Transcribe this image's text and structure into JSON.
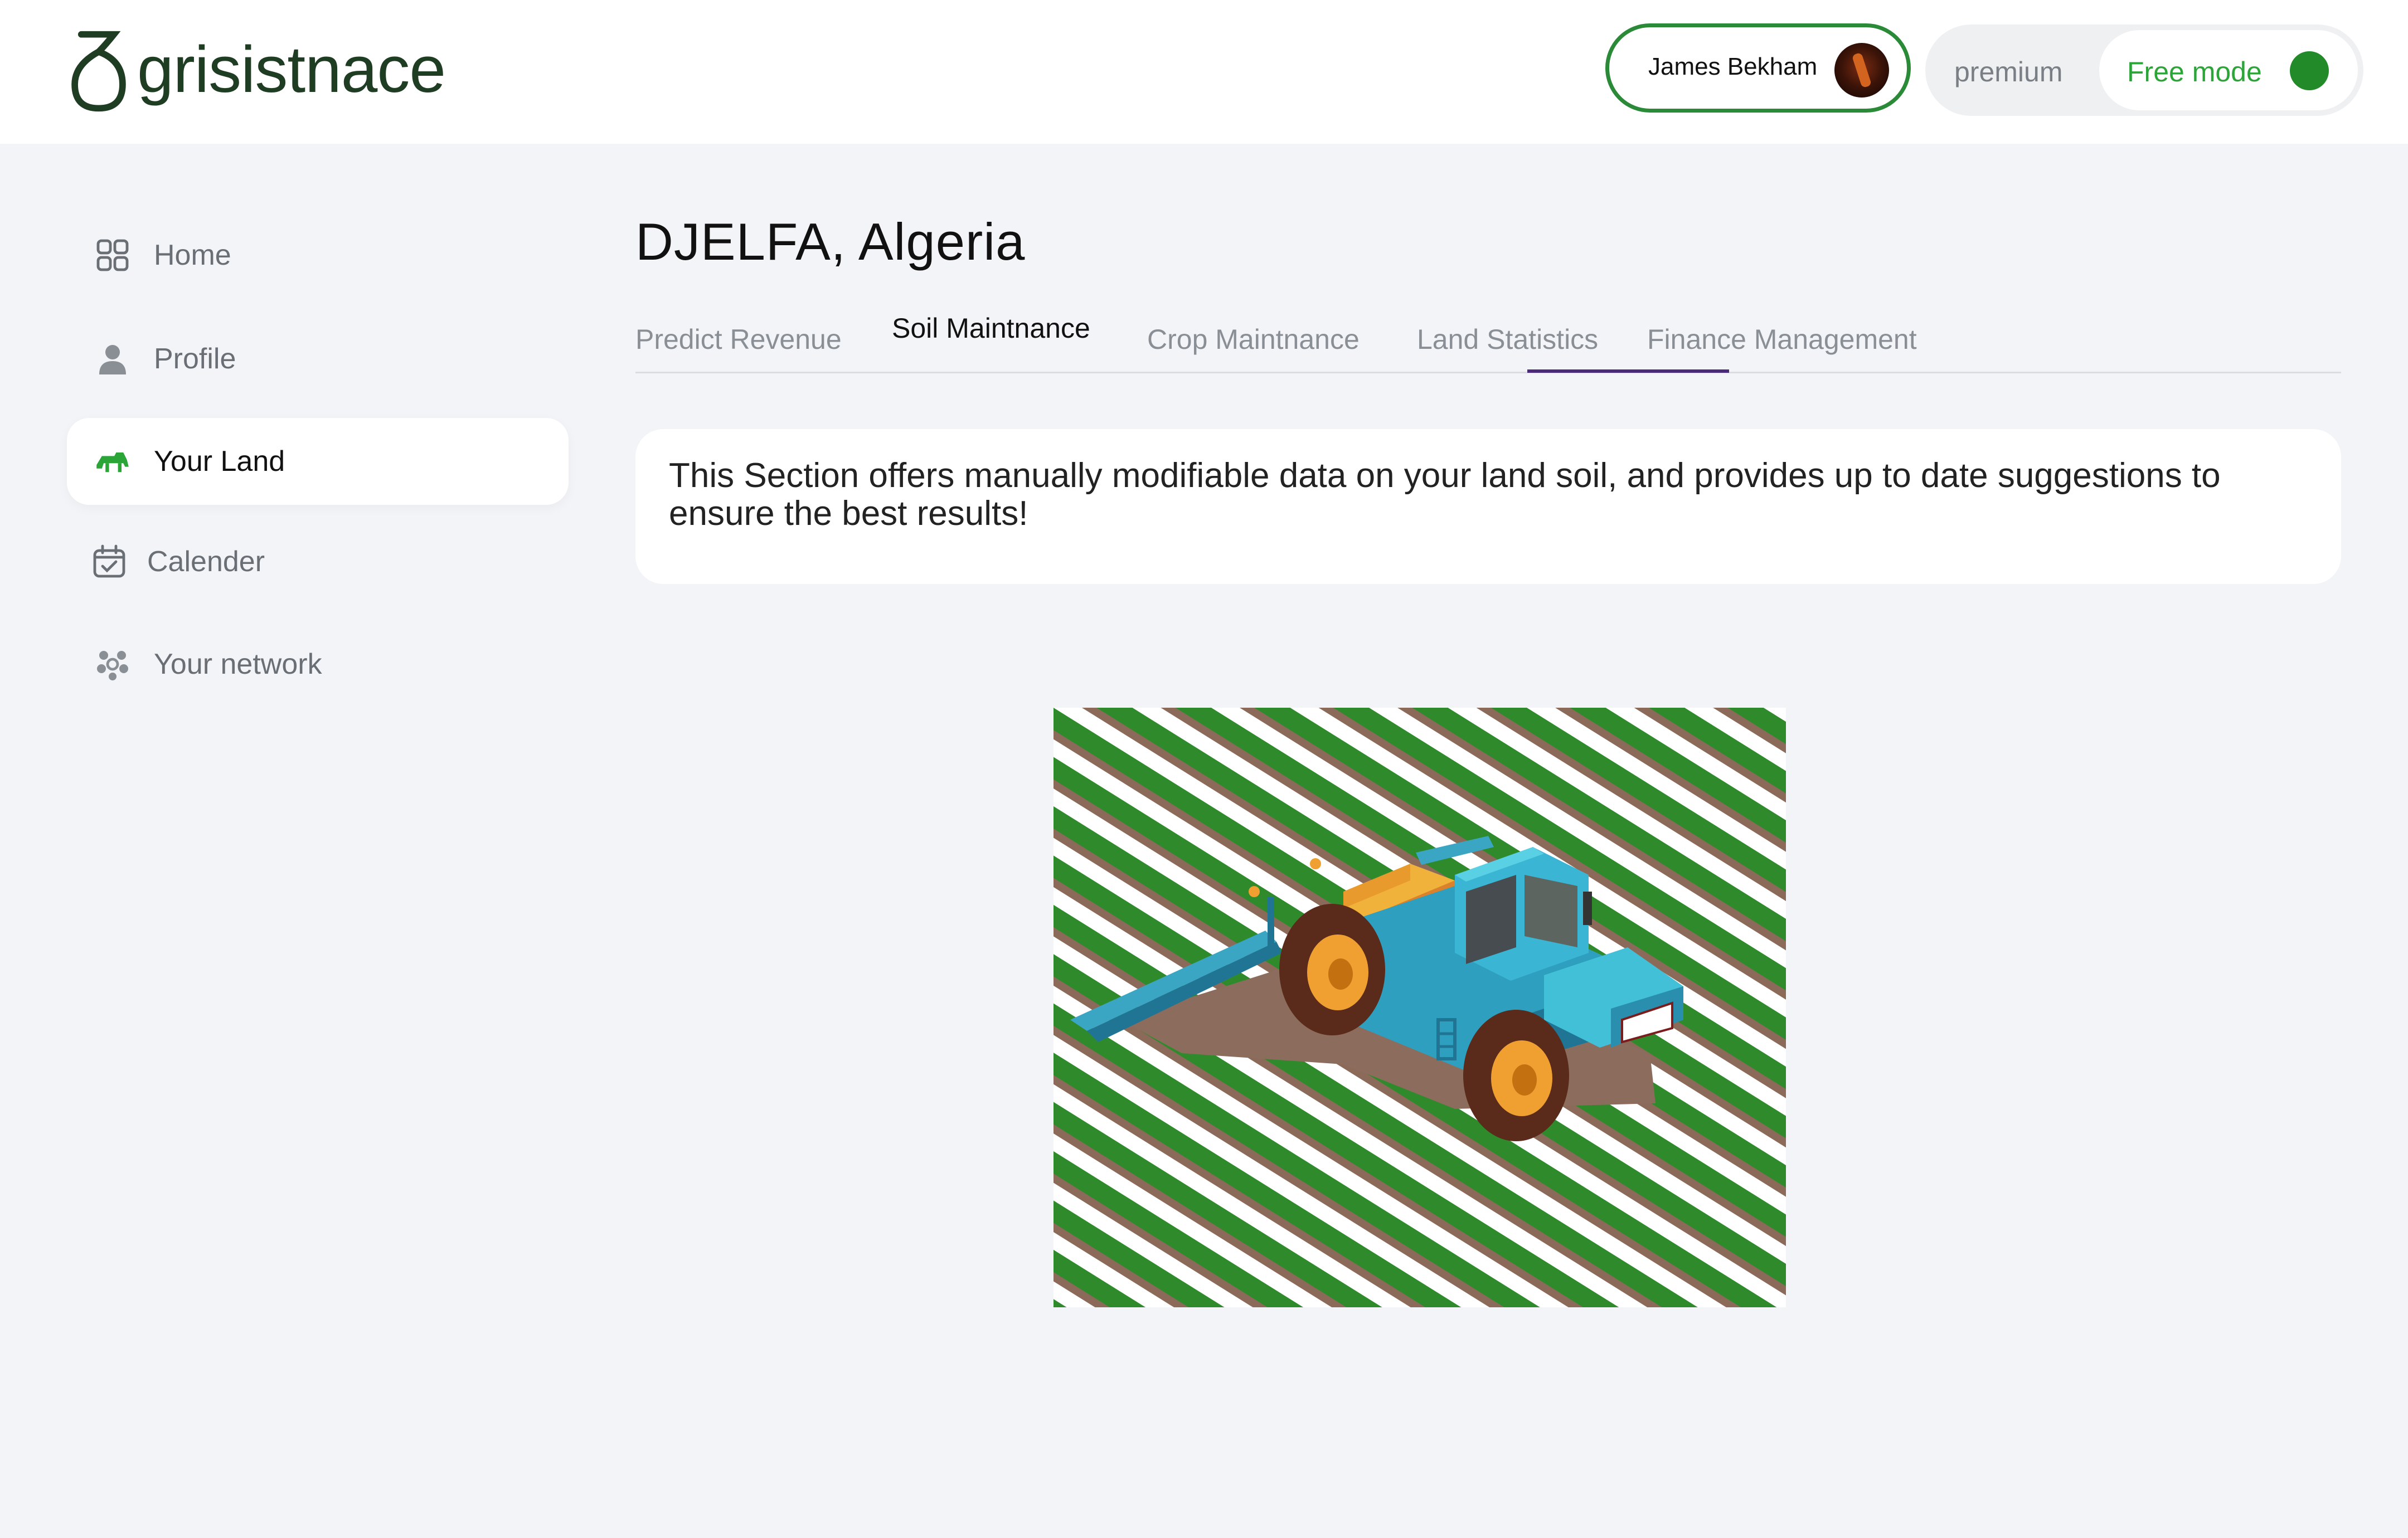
{
  "header": {
    "logo_text": "grisistnace",
    "user_name": "James Bekham",
    "mode_premium_label": "premium",
    "mode_free_label": "Free mode",
    "active_mode_color": "#238a2a"
  },
  "sidebar": {
    "items": [
      {
        "label": "Home",
        "icon": "grid-icon"
      },
      {
        "label": "Profile",
        "icon": "user-icon"
      },
      {
        "label": "Your Land",
        "icon": "tractor-icon",
        "active": true
      },
      {
        "label": "Calender",
        "icon": "calendar-icon"
      },
      {
        "label": "Your network",
        "icon": "network-icon"
      }
    ]
  },
  "main": {
    "title": "DJELFA, Algeria",
    "tabs": [
      {
        "label": "Predict Revenue"
      },
      {
        "label": "Soil Maintnance",
        "active": true
      },
      {
        "label": "Crop Maintnance"
      },
      {
        "label": "Land Statistics"
      },
      {
        "label": "Finance Management"
      }
    ],
    "info_text": "This Section offers manually modifiable data on your land soil, and provides up to date suggestions to ensure the best results!",
    "illustration": "tractor-sprayer-on-field"
  },
  "colors": {
    "brand_green": "#2b8a37",
    "logo_dark": "#1f3d22",
    "tab_underline": "#4b2a7a",
    "field_green": "#2f8a2c",
    "field_brown": "#8b6a5a"
  }
}
